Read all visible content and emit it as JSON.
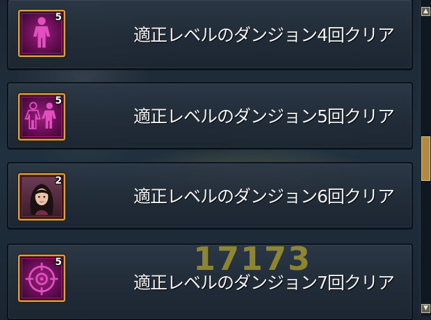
{
  "achievements": [
    {
      "label": "適正レベルのダンジョン4回クリア",
      "count": "5",
      "icon": "single-silhouette-icon"
    },
    {
      "label": "適正レベルのダンジョン5回クリア",
      "count": "5",
      "icon": "group-silhouette-icon"
    },
    {
      "label": "適正レベルのダンジョン6回クリア",
      "count": "2",
      "icon": "character-portrait-icon"
    },
    {
      "label": "適正レベルのダンジョン7回クリア",
      "count": "5",
      "icon": "crosshair-icon"
    }
  ],
  "watermark": "17173",
  "colors": {
    "icon_bg": "#6a0f58",
    "frame": "#d9a441",
    "row_bg": "#2c3846"
  }
}
